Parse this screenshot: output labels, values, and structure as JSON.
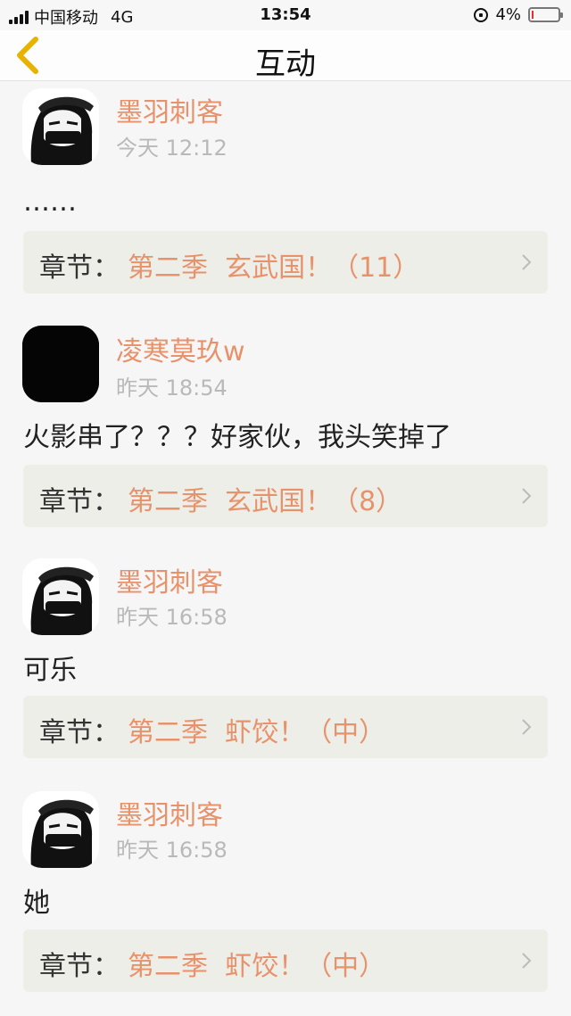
{
  "status_bar": {
    "carrier": "中国移动",
    "network": "4G",
    "time": "13:54",
    "battery": "4%"
  },
  "nav": {
    "title": "互动",
    "back_icon": "chevron-left-icon",
    "accent": "#e8b300"
  },
  "colors": {
    "username": "#e8926b",
    "chapter_title": "#e8926b",
    "timestamp": "#b9b9b9",
    "chapter_bg": "#eeeee8"
  },
  "items": [
    {
      "username": "墨羽刺客",
      "time": "今天 12:12",
      "comment": "……",
      "chapter_prefix": "章节：",
      "chapter_title": "第二季  玄武国！（11）",
      "avatar": "anime-avatar"
    },
    {
      "username": "凌寒莫玖w",
      "time": "昨天 18:54",
      "comment": "火影串了？？？好家伙，我头笑掉了",
      "chapter_prefix": "章节：",
      "chapter_title": "第二季  玄武国！（8）",
      "avatar": "black-avatar"
    },
    {
      "username": "墨羽刺客",
      "time": "昨天 16:58",
      "comment": "可乐",
      "chapter_prefix": "章节：",
      "chapter_title": "第二季  虾饺！（中）",
      "avatar": "anime-avatar"
    },
    {
      "username": "墨羽刺客",
      "time": "昨天 16:58",
      "comment": "她",
      "chapter_prefix": "章节：",
      "chapter_title": "第二季  虾饺！（中）",
      "avatar": "anime-avatar"
    }
  ]
}
